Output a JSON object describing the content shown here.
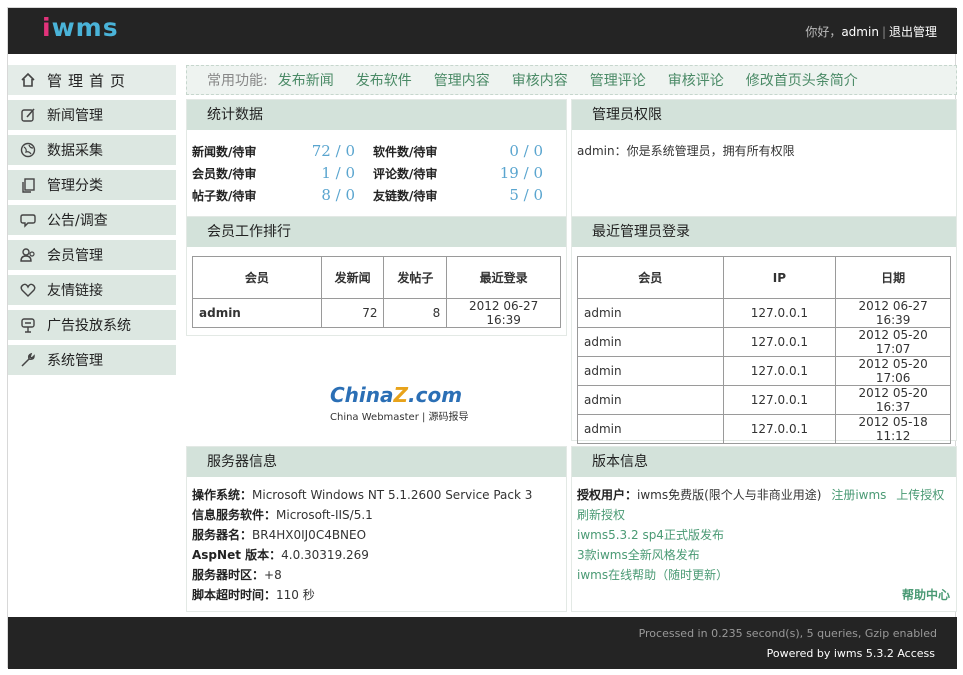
{
  "header": {
    "logo_a": "i",
    "logo_b": "wms",
    "greeting": "你好，",
    "user": "admin",
    "sep": "|",
    "logout": "退出管理"
  },
  "sidebar": {
    "items": [
      {
        "label": "管理首页",
        "icon": "home-icon"
      },
      {
        "label": "新闻管理",
        "icon": "edit-icon"
      },
      {
        "label": "数据采集",
        "icon": "globe-icon"
      },
      {
        "label": "管理分类",
        "icon": "copy-icon"
      },
      {
        "label": "公告/调查",
        "icon": "chat-icon"
      },
      {
        "label": "会员管理",
        "icon": "users-icon"
      },
      {
        "label": "友情链接",
        "icon": "heart-icon"
      },
      {
        "label": "广告投放系统",
        "icon": "ad-icon"
      },
      {
        "label": "系统管理",
        "icon": "wrench-icon"
      }
    ]
  },
  "quick": {
    "label": "常用功能:",
    "links": [
      "发布新闻",
      "发布软件",
      "管理内容",
      "审核内容",
      "管理评论",
      "审核评论",
      "修改首页头条简介"
    ]
  },
  "stats": {
    "title": "统计数据",
    "rows": [
      {
        "l1": "新闻数/待审",
        "v1": "72 / 0",
        "l2": "软件数/待审",
        "v2": "0 / 0"
      },
      {
        "l1": "会员数/待审",
        "v1": "1 / 0",
        "l2": "评论数/待审",
        "v2": "19 / 0"
      },
      {
        "l1": "帖子数/待审",
        "v1": "8 / 0",
        "l2": "友链数/待审",
        "v2": "5 / 0"
      }
    ]
  },
  "perm": {
    "title": "管理员权限",
    "text": "admin：你是系统管理员，拥有所有权限"
  },
  "rank": {
    "title": "会员工作排行",
    "headers": [
      "会员",
      "发新闻",
      "发帖子",
      "最近登录"
    ],
    "rows": [
      {
        "user": "admin",
        "news": "72",
        "posts": "8",
        "last": "2012 06-27 16:39"
      }
    ]
  },
  "logins": {
    "title": "最近管理员登录",
    "headers": [
      "会员",
      "IP",
      "日期"
    ],
    "rows": [
      {
        "user": "admin",
        "ip": "127.0.0.1",
        "date": "2012 06-27 16:39"
      },
      {
        "user": "admin",
        "ip": "127.0.0.1",
        "date": "2012 05-20 17:07"
      },
      {
        "user": "admin",
        "ip": "127.0.0.1",
        "date": "2012 05-20 17:06"
      },
      {
        "user": "admin",
        "ip": "127.0.0.1",
        "date": "2012 05-20 16:37"
      },
      {
        "user": "admin",
        "ip": "127.0.0.1",
        "date": "2012 05-18 11:12"
      }
    ]
  },
  "brand": {
    "main_a": "China",
    "main_z": "Z",
    "main_b": ".com",
    "sub": "China Webmaster | 源码报导"
  },
  "server": {
    "title": "服务器信息",
    "rows": [
      {
        "k": "操作系统：",
        "v": "Microsoft Windows NT 5.1.2600 Service Pack 3"
      },
      {
        "k": "信息服务软件：",
        "v": "Microsoft-IIS/5.1"
      },
      {
        "k": "服务器名：",
        "v": "BR4HX0IJ0C4BNEO"
      },
      {
        "k": "AspNet 版本：",
        "v": "4.0.30319.269"
      },
      {
        "k": "服务器时区：",
        "v": "+8"
      },
      {
        "k": "脚本超时时间：",
        "v": "110 秒"
      }
    ]
  },
  "version": {
    "title": "版本信息",
    "license_label": "授权用户：",
    "license_text": "iwms免费版(限个人与非商业用途)",
    "register": "注册iwms",
    "upload": "上传授权",
    "refresh": "刷新授权",
    "news1": "iwms5.3.2 sp4正式版发布",
    "news2": "3款iwms全新风格发布",
    "news3": "iwms在线帮助（随时更新）",
    "help": "帮助中心"
  },
  "footer": {
    "line1": "Processed in 0.235 second(s), 5 queries, Gzip enabled",
    "line2": "Powered by iwms 5.3.2 Access"
  },
  "colors": {
    "header_bg": "#242424",
    "panel_title_bg": "#d3e2da",
    "link": "#4a9a74",
    "stat_value": "#5aa5cf"
  }
}
